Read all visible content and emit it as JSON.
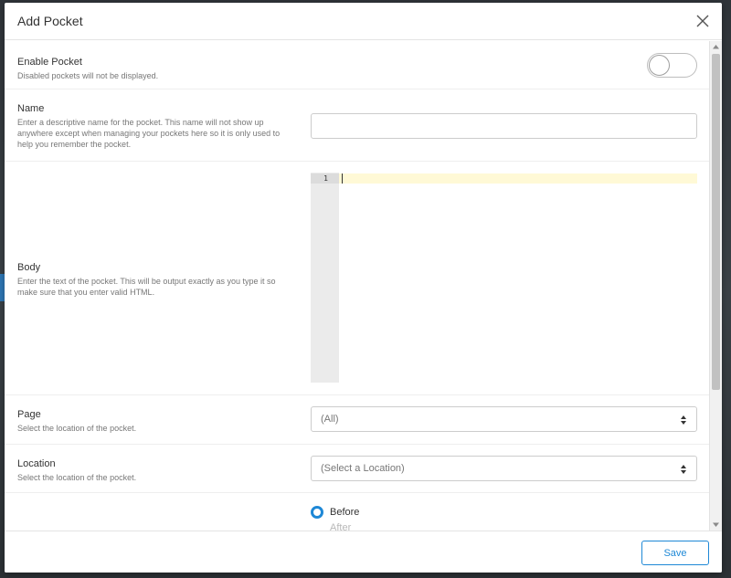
{
  "modal": {
    "title": "Add Pocket"
  },
  "enable": {
    "title": "Enable Pocket",
    "description": "Disabled pockets will not be displayed.",
    "enabled": false
  },
  "name": {
    "title": "Name",
    "description": "Enter a descriptive name for the pocket. This name will not show up anywhere except when managing your pockets here so it is only used to help you remember the pocket.",
    "value": "",
    "placeholder": ""
  },
  "body": {
    "title": "Body",
    "description": "Enter the text of the pocket. This will be output exactly as you type it so make sure that you enter valid HTML.",
    "line_number": "1"
  },
  "page": {
    "title": "Page",
    "description": "Select the location of the pocket.",
    "selected": "(All)"
  },
  "location": {
    "title": "Location",
    "description": "Select the location of the pocket.",
    "selected": "(Select a Location)"
  },
  "position": {
    "options": [
      {
        "label": "Before",
        "selected": true
      },
      {
        "label": "After",
        "selected": false
      }
    ]
  },
  "footer": {
    "save_label": "Save"
  },
  "colors": {
    "accent": "#1e88d6",
    "active_line": "#fff9d6"
  },
  "icons": {
    "close": "close-icon",
    "select_arrows": "sort-arrows-icon"
  }
}
